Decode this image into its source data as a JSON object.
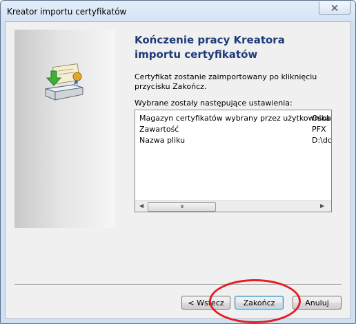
{
  "window": {
    "title": "Kreator importu certyfikatów",
    "close_icon": "close-icon"
  },
  "wizard": {
    "heading": "Kończenie pracy Kreatora importu certyfikatów",
    "description": "Certyfikat zostanie zaimportowany po kliknięciu przycisku Zakończ.",
    "settings_label": "Wybrane zostały następujące ustawienia:",
    "settings": [
      {
        "name": "Magazyn certyfikatów wybrany przez użytkownika",
        "value": "Osob"
      },
      {
        "name": "Zawartość",
        "value": "PFX"
      },
      {
        "name": "Nazwa pliku",
        "value": "D:\\dc"
      }
    ],
    "scrollbar_thumb_glyph": "III",
    "icon": "certificate-import-icon"
  },
  "buttons": {
    "back": "< Wstecz",
    "finish": "Zakończ",
    "cancel": "Anuluj"
  },
  "colors": {
    "heading": "#1e3a78",
    "annotation": "#e31e24",
    "window_frame": "#cfe0f2"
  }
}
